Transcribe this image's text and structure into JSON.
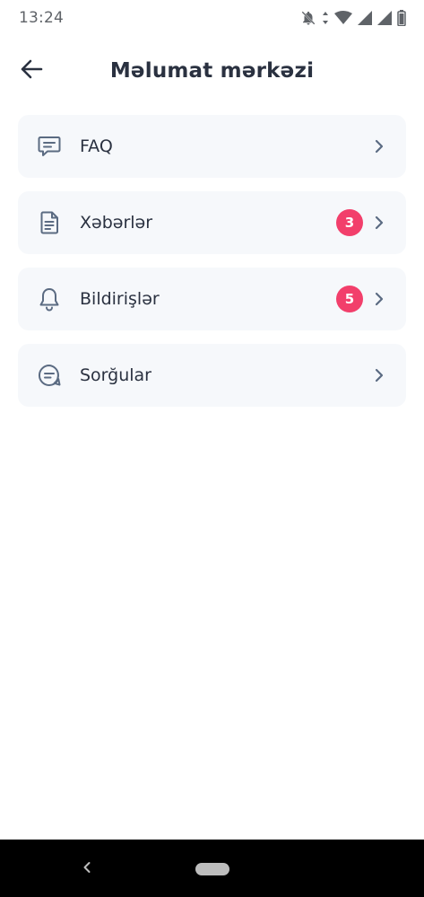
{
  "status_bar": {
    "time": "13:24",
    "icons": [
      "notifications-off-icon",
      "data-arrows-icon",
      "wifi-icon",
      "signal-icon",
      "signal-icon",
      "battery-icon"
    ]
  },
  "header": {
    "title": "Məlumat mərkəzi",
    "back_icon": "arrow-left-icon"
  },
  "menu": {
    "items": [
      {
        "label": "FAQ",
        "icon": "chat-lines-icon",
        "badge": ""
      },
      {
        "label": "Xəbərlər",
        "icon": "document-icon",
        "badge": "3"
      },
      {
        "label": "Bildirişlər",
        "icon": "bell-icon",
        "badge": "5"
      },
      {
        "label": "Sorğular",
        "icon": "chat-bubble-icon",
        "badge": ""
      }
    ]
  },
  "colors": {
    "accent_badge": "#f23f6b",
    "text_primary": "#2a3140",
    "icon": "#5b6b82",
    "card_background": "#f6f8fb",
    "nav_bar": "#000000"
  },
  "nav_bar": {
    "back_icon": "chevron-left-icon",
    "home_icon": "home-pill-icon"
  }
}
